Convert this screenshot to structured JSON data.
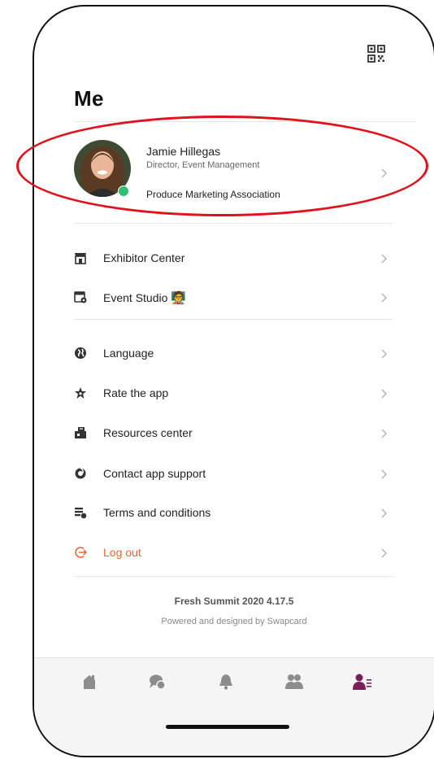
{
  "header": {
    "title": "Me",
    "qr_icon": "qr-code-icon"
  },
  "profile": {
    "name": "Jamie Hillegas",
    "role": "Director, Event Management",
    "organization": "Produce Marketing Association",
    "status_color": "#2fbf71"
  },
  "menu_primary": [
    {
      "label": "Exhibitor Center",
      "icon": "store-icon"
    },
    {
      "label": "Event Studio",
      "icon": "calendar-video-icon",
      "emoji": "🧑‍🏫"
    }
  ],
  "menu_secondary": [
    {
      "label": "Language",
      "icon": "globe-icon"
    },
    {
      "label": "Rate the app",
      "icon": "star-icon"
    },
    {
      "label": "Resources center",
      "icon": "resources-icon"
    },
    {
      "label": "Contact app support",
      "icon": "support-icon"
    },
    {
      "label": "Terms and conditions",
      "icon": "document-icon"
    }
  ],
  "logout": {
    "label": "Log out",
    "icon": "logout-icon",
    "color": "#e8643a"
  },
  "footer": {
    "app_version": "Fresh Summit 2020 4.17.5",
    "powered_by": "Powered and designed by Swapcard"
  },
  "tabbar": {
    "active_color": "#7a1f5c",
    "inactive_color": "#8c8c8c",
    "tabs": [
      {
        "icon": "home-icon",
        "active": false
      },
      {
        "icon": "chat-icon",
        "active": false
      },
      {
        "icon": "bell-icon",
        "active": false
      },
      {
        "icon": "people-icon",
        "active": false
      },
      {
        "icon": "profile-menu-icon",
        "active": true
      }
    ]
  },
  "annotation_color": "#e0121b"
}
